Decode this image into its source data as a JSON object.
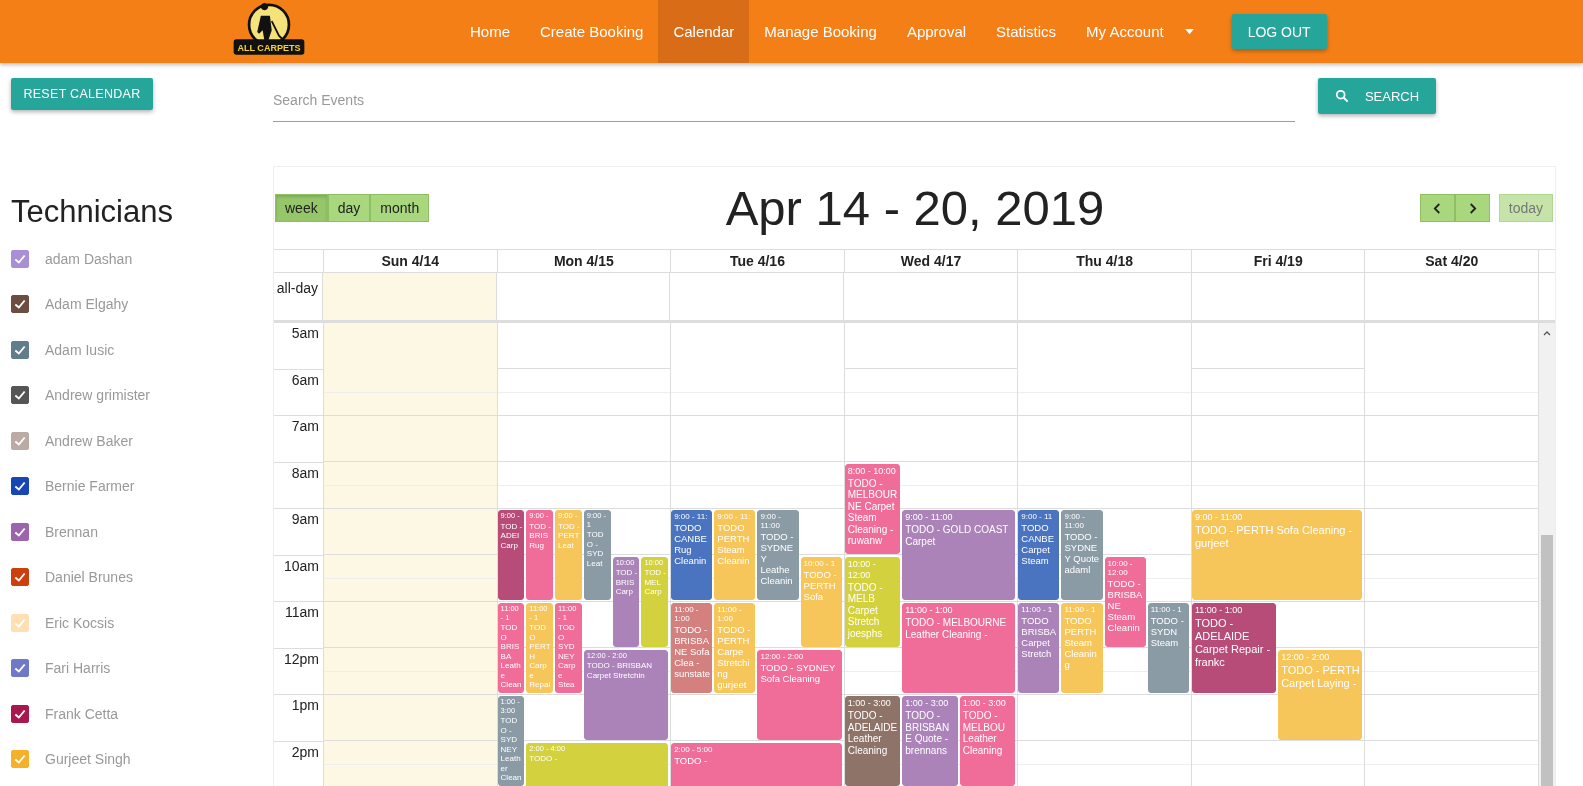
{
  "logo": {
    "text": "ALL CARPETS"
  },
  "nav": [
    {
      "label": "Home",
      "selected": false,
      "kind": "link"
    },
    {
      "label": "Create Booking",
      "selected": false,
      "kind": "link"
    },
    {
      "label": "Calendar",
      "selected": true,
      "kind": "link"
    },
    {
      "label": "Manage Booking",
      "selected": false,
      "kind": "link"
    },
    {
      "label": "Approval",
      "selected": false,
      "kind": "link"
    },
    {
      "label": "Statistics",
      "selected": false,
      "kind": "link"
    },
    {
      "label": "My Account",
      "selected": false,
      "kind": "dropdown"
    }
  ],
  "logout_button": "LOG OUT",
  "reset_button": "RESET CALENDAR",
  "technicians_title": "Technicians",
  "technicians": [
    {
      "name": "adam Dashan",
      "checked": true,
      "color": "#a98fd6"
    },
    {
      "name": "Adam Elgahy",
      "checked": true,
      "color": "#6d4c41"
    },
    {
      "name": "Adam Iusic",
      "checked": true,
      "color": "#607d8b"
    },
    {
      "name": "Andrew grimister",
      "checked": true,
      "color": "#555555"
    },
    {
      "name": "Andrew Baker",
      "checked": true,
      "color": "#bcaaa4"
    },
    {
      "name": "Bernie Farmer",
      "checked": true,
      "color": "#1846b4"
    },
    {
      "name": "Brennan",
      "checked": true,
      "color": "#9c64ad"
    },
    {
      "name": "Daniel Brunes",
      "checked": true,
      "color": "#cc4010"
    },
    {
      "name": "Eric Kocsis",
      "checked": true,
      "color": "#ffe0b2"
    },
    {
      "name": "Fari Harris",
      "checked": true,
      "color": "#7079c8"
    },
    {
      "name": "Frank Cetta",
      "checked": true,
      "color": "#a8174e"
    },
    {
      "name": "Gurjeet Singh",
      "checked": true,
      "color": "#f6b12a"
    }
  ],
  "search": {
    "placeholder": "Search Events",
    "button": "SEARCH"
  },
  "calendar": {
    "views": [
      {
        "label": "week",
        "selected": true
      },
      {
        "label": "day",
        "selected": false
      },
      {
        "label": "month",
        "selected": false
      }
    ],
    "title": "Apr 14 - 20, 2019",
    "today_button": {
      "label": "today",
      "disabled": true
    },
    "allday_label": "all-day",
    "hours": [
      "5am",
      "6am",
      "7am",
      "8am",
      "9am",
      "10am",
      "11am",
      "12pm",
      "1pm",
      "2pm"
    ],
    "days": [
      {
        "label": "Sun 4/14",
        "highlighted": true
      },
      {
        "label": "Mon 4/15",
        "highlighted": false,
        "events": [
          {
            "time": "9:00 -",
            "title": "TOD - ADEI Carp",
            "color": "#b84c78"
          },
          {
            "time": "9:00 -",
            "title": "TOD - BRIS Rug",
            "color": "#f06d99"
          },
          {
            "time": "9:00 -",
            "title": "TOD - PERT Leat",
            "color": "#f7c65a"
          },
          {
            "time": "9:00 - 1",
            "title": "TODO - SYD Leat",
            "color": "#8a9ba6"
          },
          {
            "time": "10:00",
            "title": "TOD - BRIS Carp",
            "color": "#ab83b9"
          },
          {
            "time": "10:00",
            "title": "TOD - MEL Carp",
            "color": "#d4d13f"
          },
          {
            "time": "11:00 - 1",
            "title": "TODO BRISBA Leathe Cleani",
            "color": "#f06d99"
          },
          {
            "time": "11:00 - 1",
            "title": "TODO PERTH Carpe Repair",
            "color": "#f7c65a"
          },
          {
            "time": "11:00 - 1",
            "title": "TODO SYDNEY Carpe Steam",
            "color": "#f06d99"
          },
          {
            "time": "12:00 - 2:00",
            "title": "TODO - BRISBAN Carpet Stretchin",
            "color": "#ab83b9"
          },
          {
            "time": "1:00 - 3:00",
            "title": "TODO - SYDNEY Leather Cleaning",
            "color": "#8a9ba6"
          },
          {
            "time": "2:00 - 4:00",
            "title": "TODO -",
            "color": "#d4d13f"
          }
        ]
      },
      {
        "label": "Tue 4/16",
        "highlighted": false,
        "events": [
          {
            "time": "9:00 - 11:",
            "title": "TODO CANBE Rug Cleanin",
            "color": "#4a73c0"
          },
          {
            "time": "9:00 - 11:",
            "title": "TODO PERTH Steam Cleanin",
            "color": "#f7c65a"
          },
          {
            "time": "9:00 - 11:00",
            "title": "TODO - SYDNEY Leathe Cleanin",
            "color": "#8a9ba6"
          },
          {
            "time": "10:00 - 1",
            "title": "TODO - PERTH Sofa",
            "color": "#f7c65a"
          },
          {
            "time": "11:00 - 1:00",
            "title": "TODO - BRISBANE Sofa Clea - sunstate",
            "color": "#d4807e"
          },
          {
            "time": "11:00 - 1:00",
            "title": "TODO - PERTH Carpe Stretching gurjeet",
            "color": "#f7c65a"
          },
          {
            "time": "12:00 - 2:00",
            "title": "TODO - SYDNEY Sofa Cleaning",
            "color": "#f06d99"
          },
          {
            "time": "2:00 - 5:00",
            "title": "TODO -",
            "color": "#f06d99"
          }
        ]
      },
      {
        "label": "Wed 4/17",
        "highlighted": false,
        "events": [
          {
            "time": "8:00 - 10:00",
            "title": "TODO - MELBOURNE Carpet Steam Cleaning - ruwanw",
            "color": "#f06d99"
          },
          {
            "time": "9:00 - 11:00",
            "title": "TODO - GOLD COAST Carpet",
            "color": "#ab83b9"
          },
          {
            "time": "10:00 - 12:00",
            "title": "TODO - MELB Carpet Stretch joesphs",
            "color": "#d4d13f"
          },
          {
            "time": "11:00 - 1:00",
            "title": "TODO - MELBOURNE Leather Cleaning -",
            "color": "#f06d99"
          },
          {
            "time": "1:00 - 3:00",
            "title": "TODO - ADELAIDE Leather Cleaning",
            "color": "#8d7368"
          },
          {
            "time": "1:00 - 3:00",
            "title": "TODO - BRISBANE Quote - brennans",
            "color": "#ab83b9"
          },
          {
            "time": "1:00 - 3:00",
            "title": "TODO - MELBOU Leather Cleaning",
            "color": "#f06d99"
          }
        ]
      },
      {
        "label": "Thu 4/18",
        "highlighted": false,
        "events": [
          {
            "time": "9:00 - 11",
            "title": "TODO CANBE Carpet Steam",
            "color": "#4a73c0"
          },
          {
            "time": "9:00 - 11:00",
            "title": "TODO - SYDNEY Quote adaml",
            "color": "#8a9ba6"
          },
          {
            "time": "10:00 - 12:00",
            "title": "TODO - BRISBANE Steam Cleanin",
            "color": "#f06d99"
          },
          {
            "time": "11:00 - 1",
            "title": "TODO BRISBA Carpet Stretch",
            "color": "#ab83b9"
          },
          {
            "time": "11:00 - 1",
            "title": "TODO PERTH Steam Cleaning",
            "color": "#f7c65a"
          },
          {
            "time": "11:00 - 1",
            "title": "TODO - SYDN Steam",
            "color": "#8a9ba6"
          }
        ]
      },
      {
        "label": "Fri 4/19",
        "highlighted": false,
        "events": [
          {
            "time": "9:00 - 11:00",
            "title": "TODO - PERTH Sofa Cleaning - gurjeet",
            "color": "#f7c65a"
          },
          {
            "time": "11:00 - 1:00",
            "title": "TODO - ADELAIDE Carpet Repair - frankc",
            "color": "#b84c78"
          },
          {
            "time": "12:00 - 2:00",
            "title": "TODO - PERTH Carpet Laying -",
            "color": "#f7c65a"
          }
        ]
      },
      {
        "label": "Sat 4/20",
        "highlighted": false
      }
    ]
  }
}
